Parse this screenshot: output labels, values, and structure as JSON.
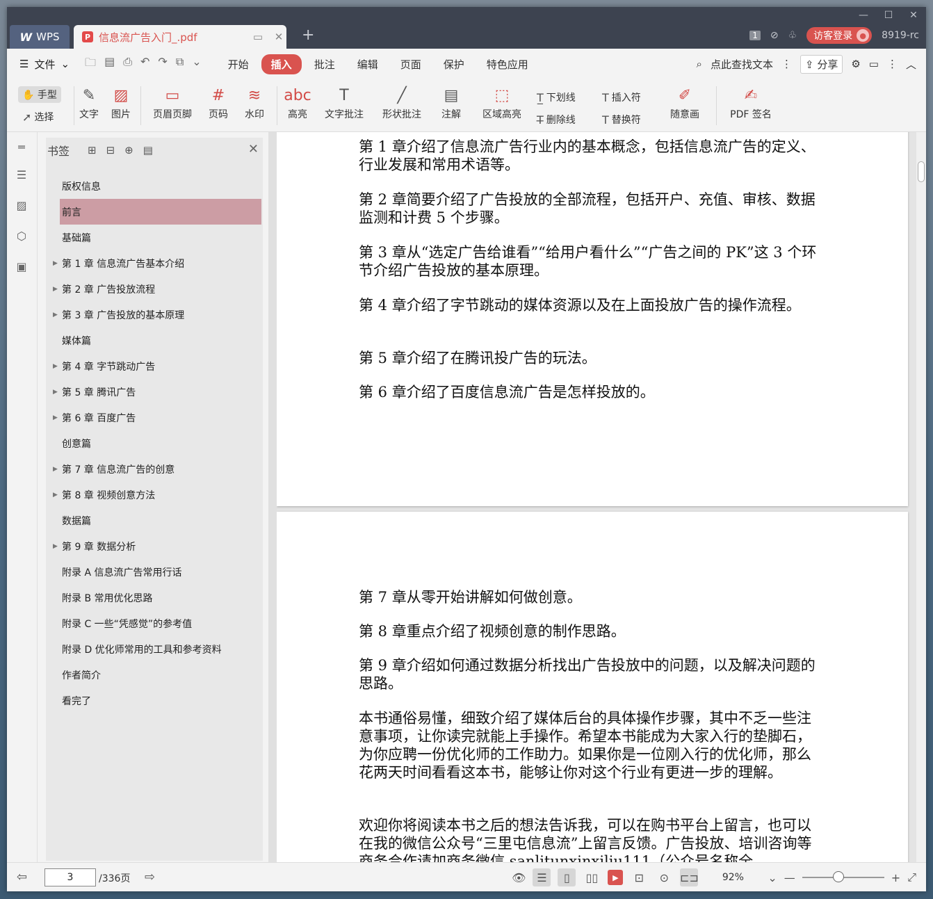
{
  "titlebar": {
    "app_tab": "WPS",
    "doc_tab": "信息流广告入门_.pdf",
    "tab_count": "1",
    "guest_login": "访客登录",
    "version": "8919-rc"
  },
  "menubar": {
    "file": "文件",
    "tabs": [
      "开始",
      "插入",
      "批注",
      "编辑",
      "页面",
      "保护",
      "特色应用"
    ],
    "active_tab": "插入",
    "search": "点此查找文本",
    "share": "分享"
  },
  "ribbon": {
    "hand": "手型",
    "select": "选择",
    "text": "文字",
    "image": "图片",
    "header_footer": "页眉页脚",
    "page_number": "页码",
    "watermark": "水印",
    "highlight": "高亮",
    "text_comment": "文字批注",
    "shape_comment": "形状批注",
    "annotation": "注解",
    "area_highlight": "区域高亮",
    "underline": "下划线",
    "strikethrough": "删除线",
    "insert_mark": "插入符",
    "replace_mark": "替换符",
    "freehand": "随意画",
    "pdf_sign": "PDF 签名"
  },
  "bookmarks": {
    "title": "书签",
    "items": [
      {
        "label": "版权信息",
        "expandable": false
      },
      {
        "label": "前言",
        "expandable": false,
        "selected": true
      },
      {
        "label": "基础篇",
        "expandable": false
      },
      {
        "label": "第 1 章 信息流广告基本介绍",
        "expandable": true
      },
      {
        "label": "第 2 章 广告投放流程",
        "expandable": true
      },
      {
        "label": "第 3 章 广告投放的基本原理",
        "expandable": true
      },
      {
        "label": "媒体篇",
        "expandable": false
      },
      {
        "label": "第 4 章 字节跳动广告",
        "expandable": true
      },
      {
        "label": "第 5 章 腾讯广告",
        "expandable": true
      },
      {
        "label": "第 6 章 百度广告",
        "expandable": true
      },
      {
        "label": "创意篇",
        "expandable": false
      },
      {
        "label": "第 7 章 信息流广告的创意",
        "expandable": true
      },
      {
        "label": "第 8 章 视频创意方法",
        "expandable": true
      },
      {
        "label": "数据篇",
        "expandable": false
      },
      {
        "label": "第 9 章 数据分析",
        "expandable": true
      },
      {
        "label": "附录 A 信息流广告常用行话",
        "expandable": false
      },
      {
        "label": "附录 B 常用优化思路",
        "expandable": false
      },
      {
        "label": "附录 C 一些“凭感觉”的参考值",
        "expandable": false
      },
      {
        "label": "附录 D 优化师常用的工具和参考资料",
        "expandable": false
      },
      {
        "label": "作者简介",
        "expandable": false
      },
      {
        "label": "看完了",
        "expandable": false
      }
    ]
  },
  "document": {
    "page1": [
      "第 1 章介绍了信息流广告行业内的基本概念，包括信息流广告的定义、行业发展和常用术语等。",
      "第 2 章简要介绍了广告投放的全部流程，包括开户、充值、审核、数据监测和计费 5 个步骤。",
      "第 3 章从“选定广告给谁看”“给用户看什么”“广告之间的 PK”这 3 个环节介绍广告投放的基本原理。",
      "第 4 章介绍了字节跳动的媒体资源以及在上面投放广告的操作流程。",
      "第 5 章介绍了在腾讯投广告的玩法。",
      "第 6 章介绍了百度信息流广告是怎样投放的。"
    ],
    "page2": [
      "第 7 章从零开始讲解如何做创意。",
      "第 8 章重点介绍了视频创意的制作思路。",
      "第 9 章介绍如何通过数据分析找出广告投放中的问题，以及解决问题的思路。",
      "本书通俗易懂，细致介绍了媒体后台的具体操作步骤，其中不乏一些注意事项，让你读完就能上手操作。希望本书能成为大家入行的垫脚石，为你应聘一份优化师的工作助力。如果你是一位刚入行的优化师，那么花两天时间看看这本书，能够让你对这个行业有更进一步的理解。",
      "欢迎你将阅读本书之后的想法告诉我，可以在购书平台上留言，也可以在我的微信公众号“三里屯信息流”上留言反馈。广告投放、培训咨询等商务合作请加商务微信 sanlitunxinxiliu111（公众号名称全"
    ]
  },
  "statusbar": {
    "current_page": "3",
    "total_pages": "/336页",
    "zoom": "92%"
  },
  "colors": {
    "accent": "#d9534f",
    "titlebar": "#3d4350",
    "bookmark_selected": "#cc9da4"
  }
}
